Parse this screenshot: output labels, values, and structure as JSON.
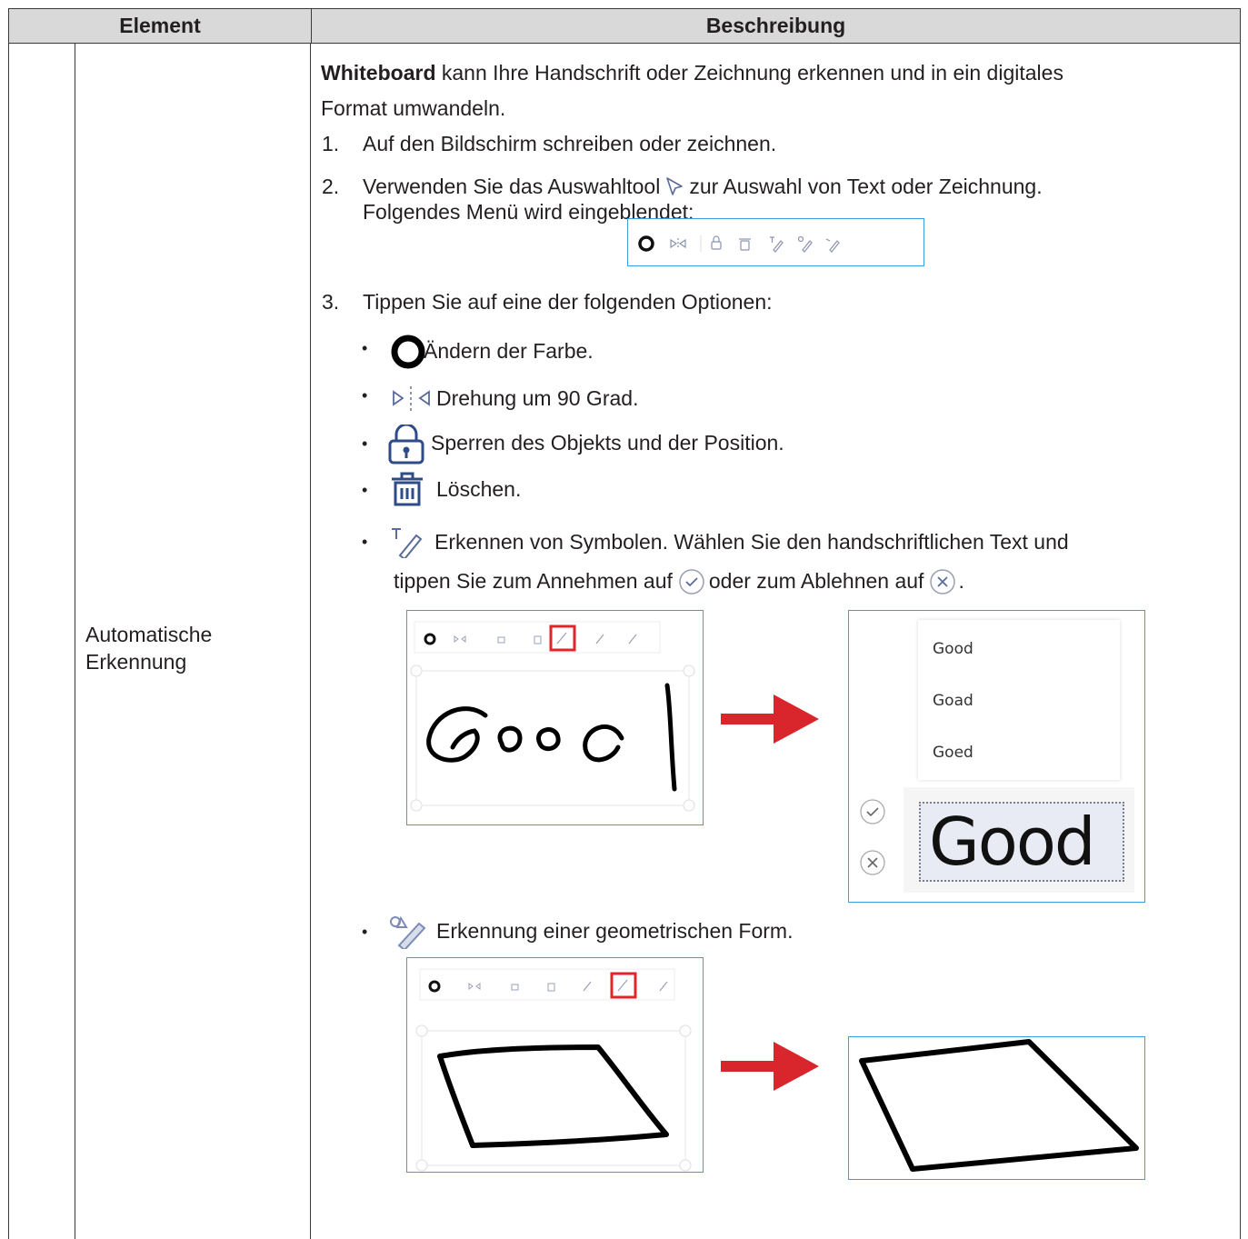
{
  "header": {
    "element": "Element",
    "description": "Beschreibung"
  },
  "row": {
    "element_label_line1": "Automatische",
    "element_label_line2": "Erkennung"
  },
  "intro": {
    "bold": "Whiteboard",
    "rest_line1": " kann Ihre Handschrift oder Zeichnung erkennen und in ein digitales",
    "line2": "Format umwandeln."
  },
  "steps": [
    {
      "num": "1.",
      "text": "Auf den Bildschirm schreiben oder zeichnen."
    },
    {
      "num": "2.",
      "text_before_icon": "Verwenden Sie das Auswahltool",
      "text_after_icon": "zur Auswahl von Text oder Zeichnung.",
      "line2": "Folgendes Menü wird eingeblendet:"
    },
    {
      "num": "3.",
      "text": "Tippen Sie auf eine der folgenden Optionen:"
    }
  ],
  "options": [
    {
      "icon": "circle-color-icon",
      "text": "Ändern der Farbe."
    },
    {
      "icon": "flip-icon",
      "text": "Drehung um 90 Grad."
    },
    {
      "icon": "lock-icon",
      "text": "Sperren des Objekts und der Position."
    },
    {
      "icon": "trash-icon",
      "text": "Löschen."
    },
    {
      "icon": "text-recognize-icon",
      "text": "Erkennen von Symbolen. Wählen Sie den handschriftlichen Text und",
      "line2_before": "tippen Sie zum Annehmen auf",
      "line2_middle": "oder zum Ablehnen auf",
      "line2_end": "."
    },
    {
      "icon": "shape-recognize-icon",
      "text": "Erkennung einer geometrischen Form."
    }
  ],
  "recognition": {
    "candidates": [
      "Good",
      "Goad",
      "Goed"
    ],
    "result": "Good"
  },
  "colors": {
    "header_bg": "#d9d9d9",
    "border": "#3a3a3a",
    "frame": "#3aa0e0",
    "arrow": "#d9262c",
    "highlight": "#e0252b"
  }
}
